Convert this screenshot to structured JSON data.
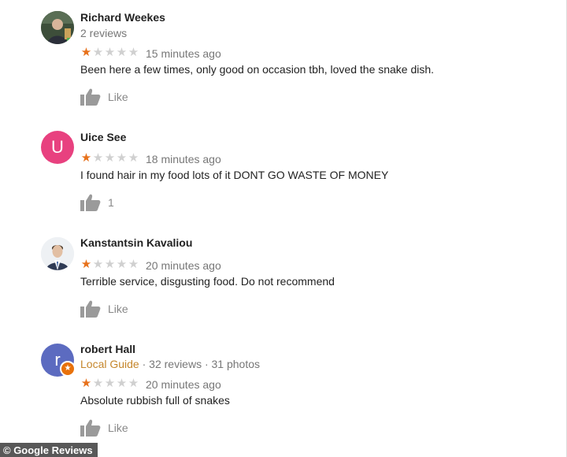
{
  "reviews": [
    {
      "author": "Richard Weekes",
      "meta": "2 reviews",
      "rating": 1,
      "time": "15 minutes ago",
      "text": "Been here a few times, only good on occasion tbh, loved the snake dish.",
      "like_label": "Like"
    },
    {
      "author": "Uice See",
      "avatar_letter": "U",
      "avatar_color": "#e8417f",
      "rating": 1,
      "time": "18 minutes ago",
      "text": "I found hair in my food lots of it DONT GO WASTE OF MONEY",
      "like_label": "1"
    },
    {
      "author": "Kanstantsin Kavaliou",
      "rating": 1,
      "time": "20 minutes ago",
      "text": "Terrible service, disgusting food. Do not recommend",
      "like_label": "Like"
    },
    {
      "author": "robert Hall",
      "avatar_letter": "r",
      "avatar_color": "#5c6bc0",
      "guide_label": "Local Guide",
      "meta": " · 32 reviews · 31 photos",
      "rating": 1,
      "time": "20 minutes ago",
      "text": "Absolute rubbish full of snakes",
      "like_label": "Like"
    }
  ],
  "star_max": 5,
  "watermark": "© Google Reviews",
  "colors": {
    "star_on": "#e7711b",
    "star_off": "#d0d0d0",
    "guide": "#c5862b"
  },
  "icons": {
    "like": "thumbs-up-icon",
    "guide_badge": "star-badge-icon"
  }
}
